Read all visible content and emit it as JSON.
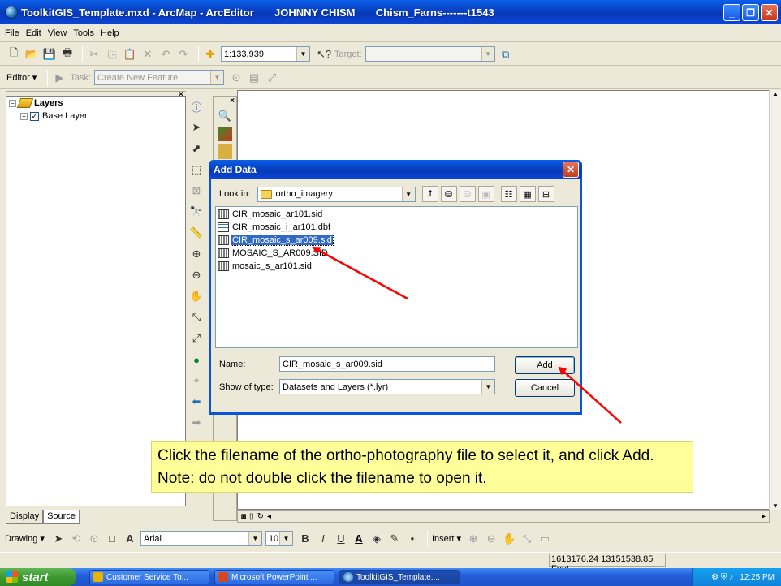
{
  "window": {
    "title": "ToolkitGIS_Template.mxd - ArcMap - ArcEditor       JOHNNY CHISM       Chism_Farns-------t1543"
  },
  "menu": [
    "File",
    "Edit",
    "View",
    "Tools",
    "Help"
  ],
  "standard_toolbar": {
    "scale": "1:133,939",
    "target_label": "Target:",
    "target_value": ""
  },
  "editor_toolbar": {
    "editor_label": "Editor ▾",
    "task_label": "Task:",
    "task_value": "Create New Feature"
  },
  "toc": {
    "root": "Layers",
    "layers": [
      {
        "name": "Base Layer",
        "checked": true
      }
    ],
    "tabs": [
      "Display",
      "Source"
    ]
  },
  "dialog": {
    "title": "Add Data",
    "look_in_label": "Look in:",
    "look_in_value": "ortho_imagery",
    "files": [
      {
        "name": "CIR_mosaic_ar101.sid",
        "kind": "raster",
        "selected": false
      },
      {
        "name": "CIR_mosaic_i_ar101.dbf",
        "kind": "table",
        "selected": false
      },
      {
        "name": "CIR_mosaic_s_ar009.sid",
        "kind": "raster",
        "selected": true
      },
      {
        "name": "MOSAIC_S_AR009.SID",
        "kind": "raster",
        "selected": false
      },
      {
        "name": "mosaic_s_ar101.sid",
        "kind": "raster",
        "selected": false
      }
    ],
    "name_label": "Name:",
    "name_value": "CIR_mosaic_s_ar009.sid",
    "type_label": "Show of type:",
    "type_value": "Datasets and Layers (*.lyr)",
    "add_button": "Add",
    "cancel_button": "Cancel"
  },
  "annotation": {
    "text": "Click the filename of the ortho-photography file to select it, and click Add. Note: do not double click the filename to open it.",
    "arrow_color": "#ff0000",
    "box_color": "#ffff99"
  },
  "drawing_toolbar": {
    "drawing_label": "Drawing ▾",
    "font": "Arial",
    "font_size": "10",
    "insert_label": "Insert ▾"
  },
  "status": {
    "coordinates": "1613176.24 13151538.85 Feet"
  },
  "taskbar": {
    "start": "start",
    "tasks": [
      "Customer Service To...",
      "Microsoft PowerPoint ...",
      "ToolkitGIS_Template...."
    ],
    "clock": "12:25 PM"
  }
}
